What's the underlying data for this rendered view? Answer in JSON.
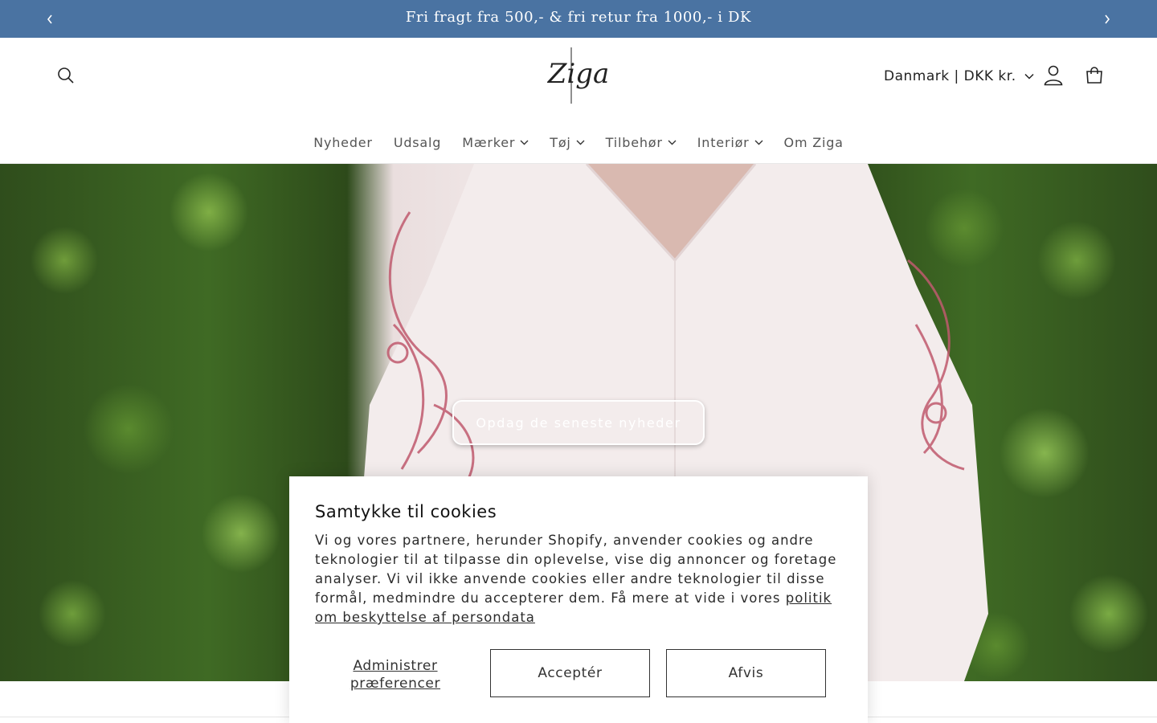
{
  "announcement": {
    "text": "Fri fragt fra 500,- & fri retur fra 1000,- i DK",
    "prev_icon": "chevron-left-icon",
    "next_icon": "chevron-right-icon",
    "background": "#4a73a2"
  },
  "header": {
    "logo_text": "Ziga",
    "locale_label": "Danmark | DKK kr.",
    "icons": {
      "search": "search-icon",
      "account": "user-icon",
      "cart": "shopping-bag-icon"
    }
  },
  "nav": {
    "items": [
      {
        "label": "Nyheder",
        "dropdown": false
      },
      {
        "label": "Udsalg",
        "dropdown": false
      },
      {
        "label": "Mærker",
        "dropdown": true
      },
      {
        "label": "Tøj",
        "dropdown": true
      },
      {
        "label": "Tilbehør",
        "dropdown": true
      },
      {
        "label": "Interiør",
        "dropdown": true
      },
      {
        "label": "Om Ziga",
        "dropdown": false
      }
    ]
  },
  "hero": {
    "cta_label": "Opdag de seneste nyheder"
  },
  "cookie_banner": {
    "title": "Samtykke til cookies",
    "body": "Vi og vores partnere, herunder Shopify, anvender cookies og andre teknologier til at tilpasse din oplevelse, vise dig annoncer og foretage analyser. Vi vil ikke anvende cookies eller andre teknologier til disse formål, medmindre du accepterer dem. Få mere at vide i vores",
    "policy_link": "politik om beskyttelse af persondata",
    "manage_label_line1": "Administrer",
    "manage_label_line2": "præferencer",
    "accept_label": "Acceptér",
    "decline_label": "Afvis"
  }
}
